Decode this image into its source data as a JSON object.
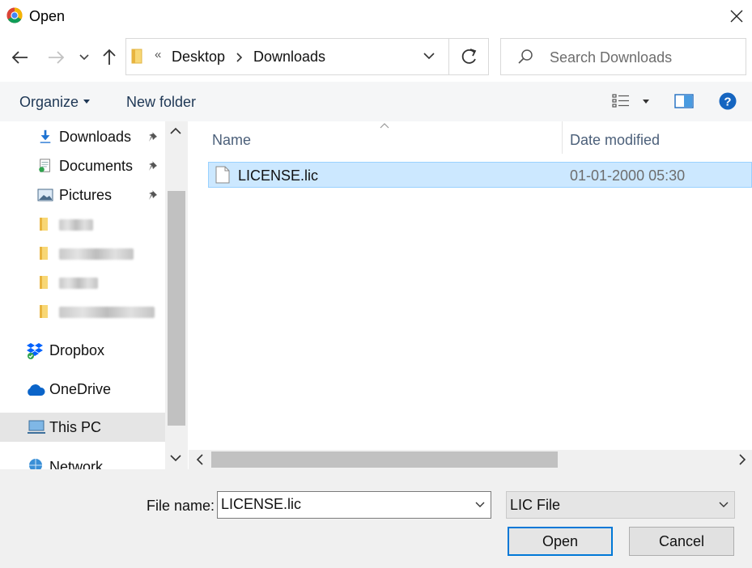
{
  "window": {
    "title": "Open"
  },
  "address_bar": {
    "overflow_marker": "«",
    "breadcrumbs": [
      "Desktop",
      "Downloads"
    ],
    "separator": "›"
  },
  "search": {
    "placeholder": "Search Downloads"
  },
  "toolbar": {
    "organize": "Organize",
    "new_folder": "New folder"
  },
  "nav_pane": {
    "quick_access": [
      {
        "label": "Downloads",
        "pinned": true,
        "icon": "download-arrow-icon"
      },
      {
        "label": "Documents",
        "pinned": true,
        "icon": "documents-icon"
      },
      {
        "label": "Pictures",
        "pinned": true,
        "icon": "pictures-icon"
      },
      {
        "label": "",
        "pinned": false,
        "icon": "folder-icon",
        "blurred": true
      },
      {
        "label": "",
        "pinned": false,
        "icon": "folder-icon",
        "blurred": true
      },
      {
        "label": "",
        "pinned": false,
        "icon": "folder-icon",
        "blurred": true
      },
      {
        "label": "",
        "pinned": false,
        "icon": "folder-icon",
        "blurred": true
      }
    ],
    "locations": [
      {
        "label": "Dropbox",
        "icon": "dropbox-icon"
      },
      {
        "label": "OneDrive",
        "icon": "onedrive-icon"
      },
      {
        "label": "This PC",
        "icon": "computer-icon",
        "selected": true
      },
      {
        "label": "Network",
        "icon": "network-icon"
      }
    ]
  },
  "file_list": {
    "columns": [
      "Name",
      "Date modified"
    ],
    "rows": [
      {
        "name": "LICENSE.lic",
        "date_modified": "01-01-2000 05:30",
        "selected": true
      }
    ]
  },
  "footer": {
    "file_name_label": "File name:",
    "file_name_value": "LICENSE.lic",
    "file_type_filter": "LIC File",
    "open_button": "Open",
    "cancel_button": "Cancel"
  },
  "colors": {
    "selection_fill": "#cce8ff",
    "selection_border": "#99d1ff",
    "accent": "#0078d7",
    "toolbar_text": "#1e3755",
    "footer_bg": "#f0f0f0"
  }
}
